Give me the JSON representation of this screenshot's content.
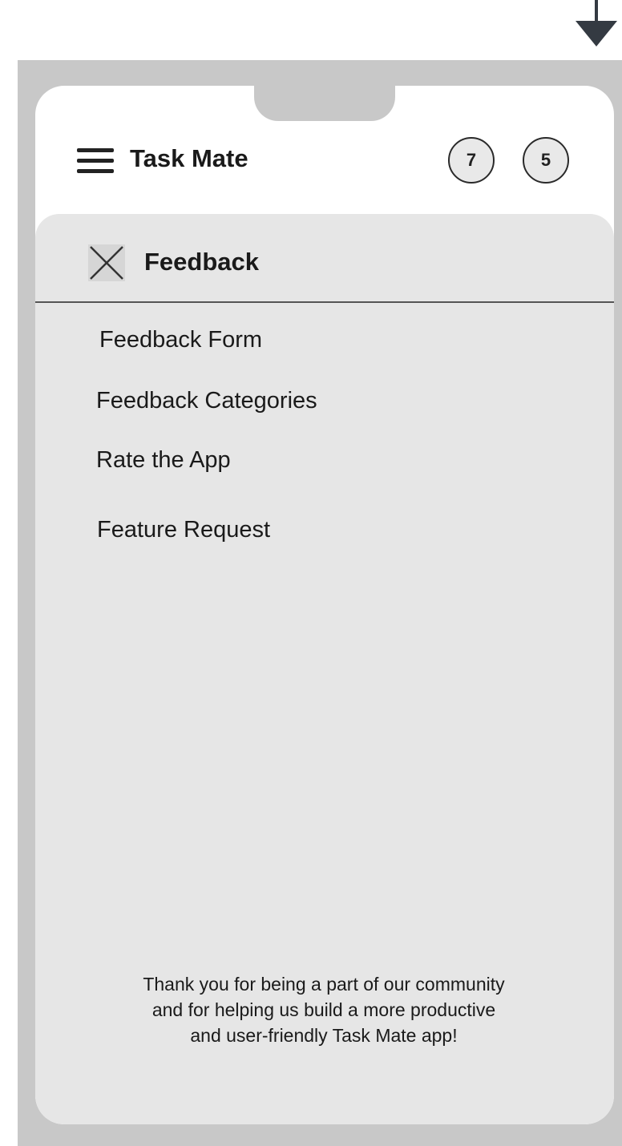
{
  "icons": {
    "scroll_indicator": "arrow-down-icon",
    "menu": "hamburger-menu-icon",
    "close": "close-x-icon"
  },
  "colors": {
    "frame": "#c8c8c8",
    "drawer": "#e6e6e6",
    "text": "#1a1a1a",
    "arrow": "#343a42"
  },
  "header": {
    "title": "Task Mate",
    "badges": [
      "7",
      "5"
    ]
  },
  "drawer": {
    "title": "Feedback",
    "items": [
      "Feedback Form",
      "Feedback Categories",
      "Rate the App",
      "Feature Request"
    ],
    "footer_lines": [
      "Thank you for being a part of our community",
      "and for helping us build a more productive",
      "and user-friendly Task Mate app!"
    ]
  }
}
